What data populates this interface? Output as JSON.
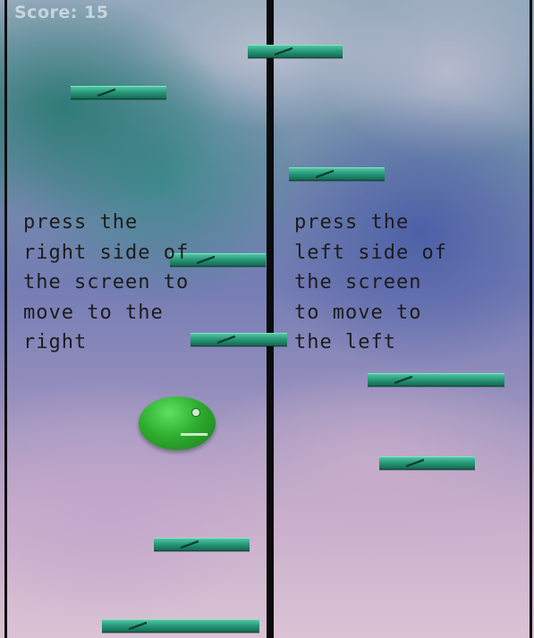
{
  "hud": {
    "score_text": "Score: 15"
  },
  "instructions": {
    "left_side": "press the\nright side of\nthe screen to\nmove to the\nright",
    "right_side": "press the\nleft side of\nthe screen\nto move to\nthe left"
  },
  "colors": {
    "platform": "#2a9a7c",
    "ball": "#2fae2f",
    "divider": "#0c0c0c"
  },
  "player": {
    "shape": "green-ball-with-face"
  }
}
